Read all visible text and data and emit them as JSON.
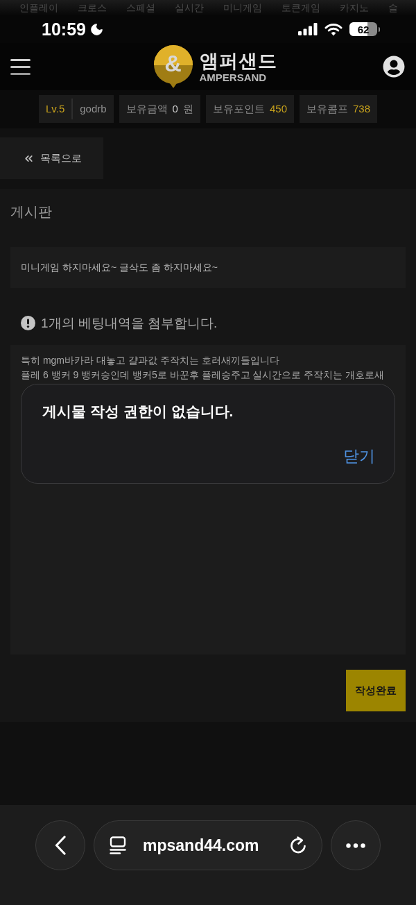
{
  "top_nav": {
    "items": [
      "인플레이",
      "크로스",
      "스페셜",
      "실시간",
      "미니게임",
      "토큰게임",
      "카지노",
      "슬"
    ]
  },
  "status_bar": {
    "time": "10:59",
    "battery": "62"
  },
  "header": {
    "logo": {
      "mark": "&",
      "title": "앰퍼샌드",
      "subtitle": "AMPERSAND"
    }
  },
  "user_info": {
    "level": "Lv.5",
    "username": "godrb",
    "stats": [
      {
        "label": "보유금액",
        "value": "0",
        "unit": "원",
        "kind": "plain"
      },
      {
        "label": "보유포인트",
        "value": "450",
        "kind": "highlight"
      },
      {
        "label": "보유콤프",
        "value": "738",
        "kind": "highlight"
      }
    ]
  },
  "back_button": {
    "label": "목록으로"
  },
  "board": {
    "title": "게시판",
    "subject": "미니게임 하지마세요~ 글삭도 좀 하지마세요~",
    "attachment_notice": "1개의 베팅내역을 첨부합니다.",
    "body_lines": [
      "특히 mgm바카라 대놓고 걀과값 주작치는 호러새끼들입니다",
      "플레 6 뱅커 9 뱅커승인데 뱅커5로 바꾼후 플레승주고 실시간으로 주작치는 개호로새"
    ],
    "submit_button": "작성완료"
  },
  "dialog": {
    "message": "게시물 작성 권한이 없습니다.",
    "button": "닫기"
  },
  "browser_bar": {
    "url": "mpsand44.com"
  }
}
